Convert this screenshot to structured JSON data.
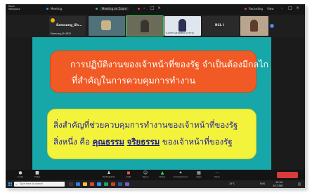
{
  "titlebar": {
    "app": "Zoom Workplace",
    "left_tab": "Meeting",
    "center_tab": "Meeting on Zoom",
    "recording": "Recording",
    "speaker_view": "View"
  },
  "participants": [
    {
      "title": "Samsung_Sh...",
      "name": "Samsung_SH-W15"
    },
    {
      "title": "",
      "name": ""
    },
    {
      "title": "",
      "name": ""
    },
    {
      "title": "",
      "name": "ห.นภัทร แสงสุขศิลป์ อาจารย์"
    },
    {
      "title": "RCL I",
      "name": ""
    },
    {
      "title": "",
      "name": ""
    }
  ],
  "slide": {
    "box1_line1": "การปฏิบัติงานของเจ้าหน้าที่ของรัฐ จำเป็นต้องมีกลไก",
    "box1_line2": "ที่สำคัญในการควบคุมการทำงาน",
    "box2_line1": "สิ่งสำคัญที่ช่วยควบคุมการทำงานของเจ้าหน้าที่ของรัฐ",
    "box2_line2_pre": "สิ่งหนึ่ง คือ ",
    "box2_line2_u1": "คุณธรรม",
    "box2_line2_u2": "จริยธรรม",
    "box2_line2_post": " ของเจ้าหน้าที่ของรัฐ"
  },
  "toolbar": {
    "audio": "Audio",
    "video": "Video",
    "participants": "Participants",
    "chat": "Chat",
    "react": "React",
    "share": "Share",
    "ai": "AI Companion",
    "apps": "Apps",
    "more": "More"
  },
  "taskbar": {
    "search_placeholder": "Type here to search",
    "weather": "25°C",
    "lang": "ENG",
    "time": "10:34",
    "date": "3/7/2567"
  },
  "colors": {
    "slide_bg": "#17a7a8",
    "box1": "#f15a24",
    "box2": "#f3f33c",
    "box2_text": "#1f1f9e"
  }
}
